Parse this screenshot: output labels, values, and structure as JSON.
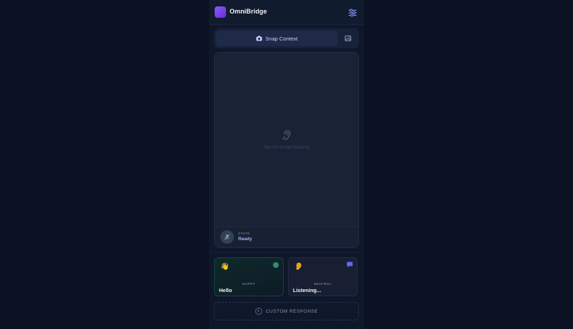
{
  "header": {
    "title": "OmniBridge",
    "settings_icon": "sliders-icon"
  },
  "snap": {
    "label": "Snap Context",
    "camera_icon": "camera-icon",
    "image_icon": "image-icon"
  },
  "listen": {
    "icon": "ear-icon",
    "hint": "Tap mic to start listening",
    "state_label": "STATE",
    "state_value": "Ready",
    "mic_icon": "mic-off-icon"
  },
  "responses": [
    {
      "emoji": "👋",
      "tag": "HAPPY",
      "text": "Hello",
      "indicator": "status-dot"
    },
    {
      "emoji": "👂",
      "tag": "NEUTRAL",
      "text": "Listening...",
      "indicator": "chat-icon"
    }
  ],
  "custom": {
    "label": "CUSTOM RESPONSE",
    "icon_glyph": "+"
  },
  "colors": {
    "accent": "#8b5cf6",
    "background": "#0b1224",
    "panel": "#0f172a",
    "state_value": "#a5b4fc",
    "happy_dot": "#2f8f73"
  }
}
